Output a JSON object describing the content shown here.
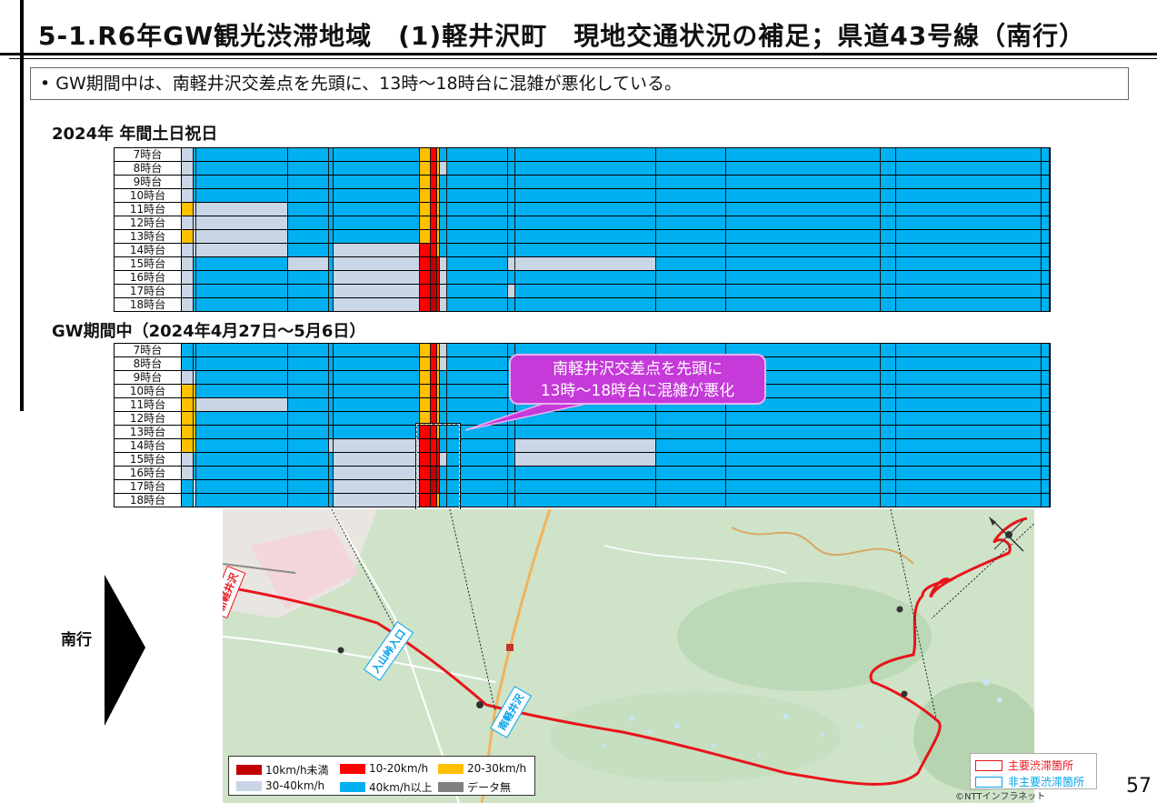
{
  "header": {
    "title": "5-1.R6年GW観光渋滞地域　(1)軽井沢町　現地交通状況の補足；県道43号線（南行）",
    "bullet": "•  GW期間中は、南軽井沢交差点を先頭に、13時〜18時台に混雑が悪化している。"
  },
  "sections": {
    "annual_title": "2024年 年間土日祝日",
    "gw_title": "GW期間中（2024年4月27日〜5月6日）"
  },
  "hours": [
    "7時台",
    "8時台",
    "9時台",
    "10時台",
    "11時台",
    "12時台",
    "13時台",
    "14時台",
    "15時台",
    "16時台",
    "17時台",
    "18時台"
  ],
  "colors": {
    "S1": "#c00000",
    "S2": "#ff0000",
    "S3": "#ffc000",
    "S4": "#c9d6e6",
    "S5": "#00b0f0",
    "S6": "#808080",
    "accent_callout": "#c53ad9",
    "route": "#e8141a"
  },
  "segment_widths": [
    13,
    3,
    101,
    45,
    5,
    95,
    12,
    7,
    3,
    8,
    67,
    8,
    155,
    77,
    170,
    17,
    160,
    9
  ],
  "annual_matrix": [
    "S4 S5 S5 S5 S5 S5 S3 S2 S3 S5 S5 S5 S5 S5 S5 S5 S5 S5",
    "S4 S5 S5 S5 S5 S5 S3 S2 S3 S4 S5 S5 S5 S5 S5 S5 S5 S5",
    "S4 S5 S5 S5 S5 S5 S3 S2 S3 S5 S5 S5 S5 S5 S5 S5 S5 S5",
    "S4 S5 S5 S5 S5 S5 S3 S2 S3 S5 S5 S5 S5 S5 S5 S5 S5 S5",
    "S3 S4 S4 S5 S5 S5 S3 S2 S3 S5 S5 S5 S5 S5 S5 S5 S5 S5",
    "S4 S4 S4 S5 S5 S5 S3 S2 S3 S5 S5 S5 S5 S5 S5 S5 S5 S5",
    "S3 S4 S4 S5 S5 S5 S3 S2 S3 S5 S5 S5 S5 S5 S5 S5 S5 S5",
    "S4 S4 S4 S5 S5 S4 S2 S2 S3 S5 S5 S5 S5 S5 S5 S5 S5 S5",
    "S4 S5 S5 S4 S5 S4 S2 S1 S2 S4 S5 S4 S4 S5 S5 S5 S5 S5",
    "S4 S5 S5 S5 S5 S4 S2 S1 S2 S4 S5 S5 S5 S5 S5 S5 S5 S5",
    "S4 S5 S5 S5 S5 S4 S2 S1 S2 S4 S5 S4 S5 S5 S5 S5 S5 S5",
    "S4 S5 S5 S5 S5 S4 S2 S1 S2 S4 S5 S5 S5 S5 S5 S5 S5 S5"
  ],
  "gw_matrix": [
    "S5 S5 S5 S5 S5 S5 S3 S2 S3 S4 S5 S5 S5 S5 S5 S5 S5 S5",
    "S5 S5 S5 S5 S5 S5 S3 S2 S3 S4 S5 S5 S5 S5 S5 S5 S5 S5",
    "S4 S4 S5 S5 S5 S5 S3 S2 S3 S5 S5 S5 S5 S5 S5 S5 S5 S5",
    "S3 S3 S5 S5 S5 S5 S3 S2 S3 S5 S5 S5 S5 S5 S5 S5 S5 S5",
    "S3 S3 S4 S5 S5 S5 S3 S2 S3 S5 S5 S5 S5 S5 S5 S5 S5 S5",
    "S3 S3 S5 S5 S5 S5 S3 S2 S3 S5 S5 S5 S5 S5 S5 S5 S5 S5",
    "S3 S3 S5 S5 S5 S5 S2 S2 S3 S5 S5 S5 S5 S5 S5 S5 S5 S5",
    "S3 S3 S5 S5 S4 S4 S2 S2 S2 S5 S5 S5 S4 S5 S5 S5 S5 S5",
    "S4 S5 S5 S5 S5 S4 S2 S2 S2 S4 S5 S5 S4 S5 S5 S5 S5 S5",
    "S4 S5 S5 S5 S5 S4 S2 S1 S2 S5 S5 S5 S5 S5 S5 S5 S5 S5",
    "S5 S4 S5 S5 S5 S4 S2 S1 S2 S5 S5 S5 S5 S5 S5 S5 S5 S5",
    "S5 S4 S5 S5 S5 S4 S2 S2 S3 S5 S5 S5 S5 S5 S5 S5 S5 S5"
  ],
  "callout": {
    "line1": "南軽井沢交差点を先頭に",
    "line2": "13時〜18時台に混雑が悪化"
  },
  "map": {
    "labels": {
      "shinkaruizawa": "新軽井沢",
      "iriyama": "入山峠入口",
      "minamikaruizawa": "南軽井沢"
    }
  },
  "direction_label": "南行",
  "legend": {
    "items": [
      {
        "label": "10km/h未満",
        "color": "#c00000"
      },
      {
        "label": "10-20km/h",
        "color": "#ff0000"
      },
      {
        "label": "20-30km/h",
        "color": "#ffc000"
      },
      {
        "label": "30-40km/h",
        "color": "#c9d6e6"
      },
      {
        "label": "40km/h以上",
        "color": "#00b0f0"
      },
      {
        "label": "データ無",
        "color": "#808080"
      }
    ]
  },
  "legend2": {
    "main_label": "主要渋滞箇所",
    "sub_label": "非主要渋滞箇所",
    "main_color": "#e8141a",
    "sub_color": "#00a0e9"
  },
  "copyright": "©NTTインフラネット",
  "page_number": "57"
}
